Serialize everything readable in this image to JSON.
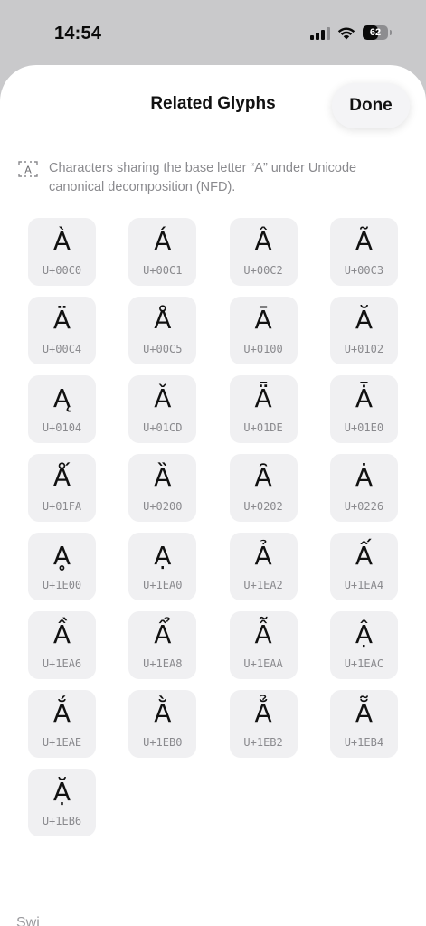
{
  "status_bar": {
    "time": "14:54",
    "battery_percent": "62",
    "battery_level": 0.62,
    "signal_bars_active": 3,
    "icons": [
      "cellular-signal-icon",
      "wifi-icon",
      "battery-icon"
    ]
  },
  "sheet": {
    "title": "Related Glyphs",
    "done_label": "Done",
    "info_icon": "character-box-icon",
    "info_icon_letter": "A",
    "info_text": "Characters sharing the base letter “A” under Unicode canonical decomposition (NFD)."
  },
  "glyphs": [
    {
      "char": "À",
      "code": "U+00C0"
    },
    {
      "char": "Á",
      "code": "U+00C1"
    },
    {
      "char": "Â",
      "code": "U+00C2"
    },
    {
      "char": "Ã",
      "code": "U+00C3"
    },
    {
      "char": "Ä",
      "code": "U+00C4"
    },
    {
      "char": "Å",
      "code": "U+00C5"
    },
    {
      "char": "Ā",
      "code": "U+0100"
    },
    {
      "char": "Ă",
      "code": "U+0102"
    },
    {
      "char": "Ą",
      "code": "U+0104"
    },
    {
      "char": "Ǎ",
      "code": "U+01CD"
    },
    {
      "char": "Ǟ",
      "code": "U+01DE"
    },
    {
      "char": "Ǡ",
      "code": "U+01E0"
    },
    {
      "char": "Ǻ",
      "code": "U+01FA"
    },
    {
      "char": "Ȁ",
      "code": "U+0200"
    },
    {
      "char": "Ȃ",
      "code": "U+0202"
    },
    {
      "char": "Ȧ",
      "code": "U+0226"
    },
    {
      "char": "Ḁ",
      "code": "U+1E00"
    },
    {
      "char": "Ạ",
      "code": "U+1EA0"
    },
    {
      "char": "Ả",
      "code": "U+1EA2"
    },
    {
      "char": "Ấ",
      "code": "U+1EA4"
    },
    {
      "char": "Ầ",
      "code": "U+1EA6"
    },
    {
      "char": "Ẩ",
      "code": "U+1EA8"
    },
    {
      "char": "Ẫ",
      "code": "U+1EAA"
    },
    {
      "char": "Ậ",
      "code": "U+1EAC"
    },
    {
      "char": "Ắ",
      "code": "U+1EAE"
    },
    {
      "char": "Ằ",
      "code": "U+1EB0"
    },
    {
      "char": "Ẳ",
      "code": "U+1EB2"
    },
    {
      "char": "Ẵ",
      "code": "U+1EB4"
    },
    {
      "char": "Ặ",
      "code": "U+1EB6"
    }
  ],
  "bottom_peek_text": "Swi"
}
